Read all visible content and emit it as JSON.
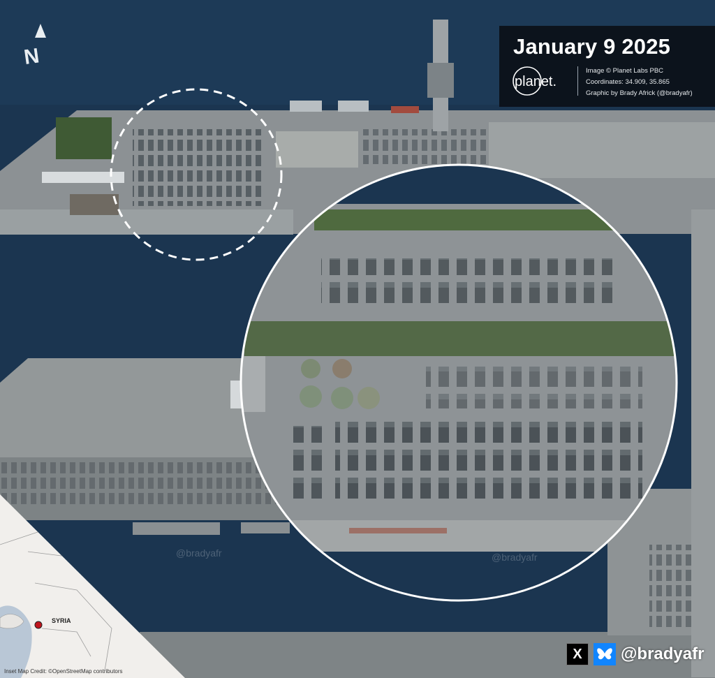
{
  "title_card": {
    "date": "January 9 2025",
    "logo_text": "planet.",
    "image_credit": "Image © Planet Labs PBC",
    "coordinates": "Coordinates: 34.909, 35.865",
    "graphic_credit": "Graphic by Brady Africk (@bradyafr)"
  },
  "north_label": "N",
  "watermarks": [
    "@bradyafr",
    "@bradyafr"
  ],
  "inset_map": {
    "country_label": "SYRIA",
    "credit": "Inset Map Credit: ©OpenStreetMap contributors"
  },
  "social": {
    "x_label": "X",
    "handle": "@bradyafr"
  },
  "colors": {
    "water": "#1b3550",
    "quay": "#8e9396",
    "card_bg": "#0a0e14",
    "bluesky": "#1185fe"
  }
}
